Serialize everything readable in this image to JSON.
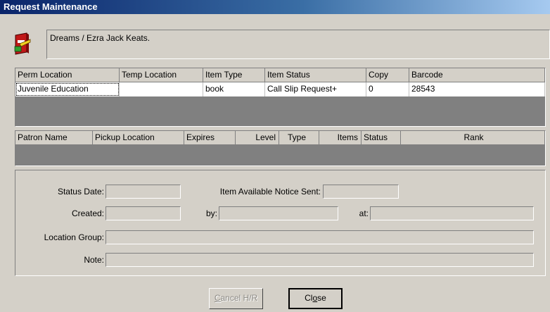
{
  "window": {
    "title": "Request Maintenance"
  },
  "item": {
    "title": "Dreams / Ezra Jack Keats."
  },
  "items_table": {
    "headers": [
      "Perm Location",
      "Temp Location",
      "Item Type",
      "Item Status",
      "Copy",
      "Barcode"
    ],
    "rows": [
      [
        "Juvenile Education",
        "",
        "book",
        "Call Slip Request+",
        "0",
        "28543"
      ]
    ]
  },
  "requests_table": {
    "headers": [
      "Patron Name",
      "Pickup Location",
      "Expires",
      "Level",
      "Type",
      "Items",
      "Status",
      "Rank"
    ],
    "rows": []
  },
  "details": {
    "status_date_label": "Status Date:",
    "status_date": "",
    "notice_label": "Item Available Notice Sent:",
    "notice": "",
    "created_label": "Created:",
    "created": "",
    "by_label": "by:",
    "by": "",
    "at_label": "at:",
    "at": "",
    "location_group_label": "Location Group:",
    "location_group": "",
    "note_label": "Note:",
    "note": ""
  },
  "buttons": {
    "cancel_hr": {
      "label": "Cancel H/R",
      "mnemonic": "C",
      "rest": "ancel H/R",
      "enabled": false
    },
    "close": {
      "label": "Close",
      "before": "Cl",
      "mnemonic": "o",
      "after": "se",
      "enabled": true
    }
  }
}
